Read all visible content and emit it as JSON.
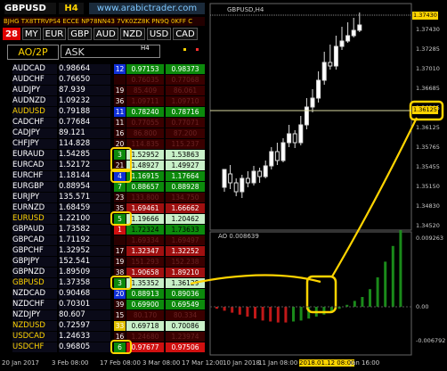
{
  "header": {
    "pair": "GBPUSD",
    "timeframe": "H4",
    "site": "www.arabictrader.com"
  },
  "banner": "BJHG TX8TTRVPS4 ECCE NP78NN43 7VK0ZZ8K PN9Q 0KFF C",
  "currencies": {
    "count": "28",
    "items": [
      "MY",
      "EUR",
      "GBP",
      "AUD",
      "NZD",
      "USD",
      "CAD"
    ]
  },
  "panel": {
    "indicator": "AO/2P",
    "price_type": "ASK",
    "tf_label": "H4"
  },
  "rows": [
    {
      "symbol": "AUDCAD",
      "price": "0.98664",
      "n": "12",
      "bid": "0.97153",
      "ask": "0.98373",
      "ncolor": "#1030d8",
      "bidbg": "#0c8a0c",
      "askbg": "#0c8a0c",
      "bidc": "#ffffff",
      "askc": "#ffffff"
    },
    {
      "symbol": "AUDCHF",
      "price": "0.76650",
      "n": "",
      "bid": "0.76035",
      "ask": "0.77068",
      "ncolor": "#2a0000",
      "bidbg": "#3a0000",
      "askbg": "#3a0000",
      "bidc": "#6a2222",
      "askc": "#6a2222"
    },
    {
      "symbol": "AUDJPY",
      "price": "87.939",
      "n": "19",
      "bid": "85.409",
      "ask": "86.061",
      "ncolor": "#2a0000",
      "bidbg": "#3a0000",
      "askbg": "#3a0000",
      "bidc": "#6a2222",
      "askc": "#6a2222"
    },
    {
      "symbol": "AUDNZD",
      "price": "1.09232",
      "n": "36",
      "bid": "1.09711",
      "ask": "1.09710",
      "ncolor": "#2a0000",
      "bidbg": "#3a0000",
      "askbg": "#3a0000",
      "bidc": "#6a2222",
      "askc": "#6a2222"
    },
    {
      "symbol": "AUDUSD",
      "price": "0.79188",
      "n": "11",
      "bid": "0.78240",
      "ask": "0.78716",
      "ncolor": "#1030d8",
      "bidbg": "#0c8a0c",
      "askbg": "#0c8a0c",
      "bidc": "#ffffff",
      "askc": "#ffffff"
    },
    {
      "symbol": "CADCHF",
      "price": "0.77684",
      "n": "11",
      "bid": "0.77055",
      "ask": "0.77071",
      "ncolor": "#2a0000",
      "bidbg": "#3a0000",
      "askbg": "#3a0000",
      "bidc": "#6a2222",
      "askc": "#6a2222"
    },
    {
      "symbol": "CADJPY",
      "price": "89.121",
      "n": "16",
      "bid": "86.800",
      "ask": "87.200",
      "ncolor": "#2a0000",
      "bidbg": "#3a0000",
      "askbg": "#3a0000",
      "bidc": "#6a2222",
      "askc": "#6a2222"
    },
    {
      "symbol": "CHFJPY",
      "price": "114.828",
      "n": "20",
      "bid": "114.835",
      "ask": "115.237",
      "ncolor": "#2a0000",
      "bidbg": "#3a0000",
      "askbg": "#3a0000",
      "bidc": "#6a2222",
      "askc": "#6a2222"
    },
    {
      "symbol": "EURAUD",
      "price": "1.54285",
      "n": "3",
      "bid": "1.52952",
      "ask": "1.53863",
      "ncolor": "#0c8a0c",
      "bidbg": "#c8f0c8",
      "askbg": "#c8f0c8",
      "bidc": "#000000",
      "askc": "#000000"
    },
    {
      "symbol": "EURCAD",
      "price": "1.52172",
      "n": "21",
      "bid": "1.48927",
      "ask": "1.49927",
      "ncolor": "#2a0000",
      "bidbg": "#c8f0c8",
      "askbg": "#c8f0c8",
      "bidc": "#000000",
      "askc": "#000000"
    },
    {
      "symbol": "EURCHF",
      "price": "1.18144",
      "n": "4",
      "bid": "1.16915",
      "ask": "1.17664",
      "ncolor": "#1030d8",
      "bidbg": "#0c8a0c",
      "askbg": "#0c8a0c",
      "bidc": "#ffffff",
      "askc": "#ffffff"
    },
    {
      "symbol": "EURGBP",
      "price": "0.88954",
      "n": "7",
      "bid": "0.88657",
      "ask": "0.88928",
      "ncolor": "#0c8a0c",
      "bidbg": "#0c8a0c",
      "askbg": "#0c8a0c",
      "bidc": "#ffffff",
      "askc": "#ffffff"
    },
    {
      "symbol": "EURJPY",
      "price": "135.571",
      "n": "23",
      "bid": "133.800",
      "ask": "134.750",
      "ncolor": "#2a0000",
      "bidbg": "#3a0000",
      "askbg": "#3a0000",
      "bidc": "#6a2222",
      "askc": "#6a2222"
    },
    {
      "symbol": "EURNZD",
      "price": "1.68459",
      "n": "35",
      "bid": "1.69461",
      "ask": "1.66662",
      "ncolor": "#2a0000",
      "bidbg": "#a01010",
      "askbg": "#a01010",
      "bidc": "#ffffff",
      "askc": "#ffffff"
    },
    {
      "symbol": "EURUSD",
      "price": "1.22100",
      "n": "5",
      "bid": "1.19666",
      "ask": "1.20462",
      "ncolor": "#0c8a0c",
      "bidbg": "#c8f0c8",
      "askbg": "#c8f0c8",
      "bidc": "#000000",
      "askc": "#000000"
    },
    {
      "symbol": "GBPAUD",
      "price": "1.73582",
      "n": "1",
      "bid": "1.72324",
      "ask": "1.73633",
      "ncolor": "#d01010",
      "bidbg": "#0c8a0c",
      "askbg": "#0c8a0c",
      "bidc": "#000000",
      "askc": "#000000"
    },
    {
      "symbol": "GBPCAD",
      "price": "1.71192",
      "n": "",
      "bid": "1.69334",
      "ask": "1.69497",
      "ncolor": "#2a0000",
      "bidbg": "#3a0000",
      "askbg": "#3a0000",
      "bidc": "#6a2222",
      "askc": "#6a2222"
    },
    {
      "symbol": "GBPCHF",
      "price": "1.32952",
      "n": "17",
      "bid": "1.32347",
      "ask": "1.32252",
      "ncolor": "#2a0000",
      "bidbg": "#a01010",
      "askbg": "#a01010",
      "bidc": "#ffffff",
      "askc": "#ffffff"
    },
    {
      "symbol": "GBPJPY",
      "price": "152.541",
      "n": "19",
      "bid": "151.293",
      "ask": "152.238",
      "ncolor": "#2a0000",
      "bidbg": "#3a0000",
      "askbg": "#3a0000",
      "bidc": "#6a2222",
      "askc": "#6a2222"
    },
    {
      "symbol": "GBPNZD",
      "price": "1.89509",
      "n": "38",
      "bid": "1.90658",
      "ask": "1.89210",
      "ncolor": "#2a0000",
      "bidbg": "#a01010",
      "askbg": "#a01010",
      "bidc": "#ffffff",
      "askc": "#ffffff"
    },
    {
      "symbol": "GBPUSD",
      "price": "1.37358",
      "n": "3",
      "bid": "1.35352",
      "ask": "1.36129",
      "ncolor": "#0c8a0c",
      "bidbg": "#c8f0c8",
      "askbg": "#c8f0c8",
      "bidc": "#000000",
      "askc": "#000000"
    },
    {
      "symbol": "NZDCAD",
      "price": "0.90468",
      "n": "20",
      "bid": "0.88913",
      "ask": "0.89036",
      "ncolor": "#1030d8",
      "bidbg": "#0c8a0c",
      "askbg": "#0c8a0c",
      "bidc": "#ffffff",
      "askc": "#ffffff"
    },
    {
      "symbol": "NZDCHF",
      "price": "0.70301",
      "n": "39",
      "bid": "0.69900",
      "ask": "0.69549",
      "ncolor": "#2a0000",
      "bidbg": "#0c8a0c",
      "askbg": "#0c8a0c",
      "bidc": "#ffffff",
      "askc": "#ffffff"
    },
    {
      "symbol": "NZDJPY",
      "price": "80.607",
      "n": "15",
      "bid": "80.170",
      "ask": "80.334",
      "ncolor": "#2a0000",
      "bidbg": "#3a0000",
      "askbg": "#3a0000",
      "bidc": "#6a2222",
      "askc": "#6a2222"
    },
    {
      "symbol": "NZDUSD",
      "price": "0.72597",
      "n": "33",
      "bid": "0.69718",
      "ask": "0.70086",
      "ncolor": "#e0c000",
      "bidbg": "#c8f0c8",
      "askbg": "#c8f0c8",
      "bidc": "#000000",
      "askc": "#000000"
    },
    {
      "symbol": "USDCAD",
      "price": "1.24633",
      "n": "16",
      "bid": "1.24680",
      "ask": "1.23974",
      "ncolor": "#2a0000",
      "bidbg": "#3a0000",
      "askbg": "#3a0000",
      "bidc": "#6a2222",
      "askc": "#6a2222"
    },
    {
      "symbol": "USDCHF",
      "price": "0.96805",
      "n": "6",
      "bid": "0.97677",
      "ask": "0.97506",
      "ncolor": "#0c8a0c",
      "bidbg": "#d01010",
      "askbg": "#d01010",
      "bidc": "#ffffff",
      "askc": "#ffffff"
    }
  ],
  "chart": {
    "title": "GBPUSD,H4",
    "ao_label": "AO 0.008639",
    "price_labels": [
      "1.37430",
      "1.37285",
      "1.37010",
      "1.36685",
      "1.36385",
      "1.36125",
      "1.35765",
      "1.35455",
      "1.35150",
      "1.34830",
      "1.34520"
    ],
    "ao_labels": [
      "0.009263",
      "0.00",
      "-0.006792"
    ],
    "current_price": "1.37430",
    "marked_price": "1.36125",
    "dates": [
      "20 Jan 2017",
      "3 Feb 08:00",
      "17 Feb 08:00",
      "3 Mar 08:00",
      "17 Mar 12:00",
      "10 Jan 2018",
      "11 Jan 08:00",
      "2018.01.12 08:00",
      "Jan 16:00"
    ]
  },
  "colors": {
    "accent_yellow": "#ffd400",
    "candle_up": "#ffffff",
    "ao_up": "#1a8a1a",
    "ao_down": "#c01818"
  }
}
